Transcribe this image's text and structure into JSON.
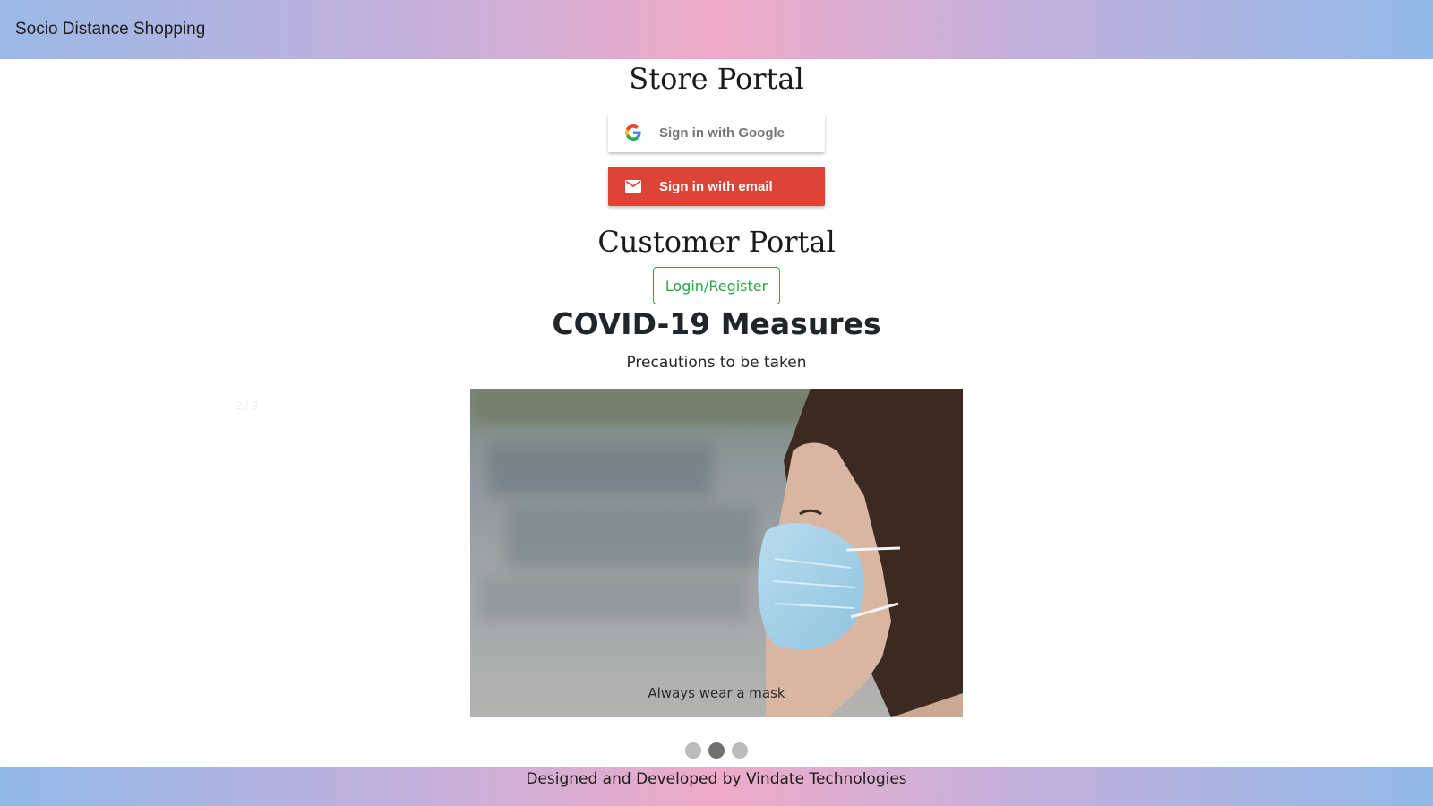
{
  "header": {
    "brand": "Socio Distance Shopping"
  },
  "store_portal": {
    "title": "Store Portal",
    "google_label": "Sign in with Google",
    "email_label": "Sign in with email"
  },
  "customer_portal": {
    "title": "Customer Portal",
    "login_label": "Login/Register"
  },
  "covid": {
    "title": "COVID-19 Measures",
    "subtitle": "Precautions to be taken",
    "slide_counter": "2 / 3",
    "caption": "Always wear a mask",
    "slides_total": 3,
    "active_slide": 2
  },
  "footer": {
    "text": "Designed and Developed by Vindate Technologies"
  },
  "colors": {
    "email_button": "#db4437",
    "login_outline": "#28a745",
    "active_dot": "#707070",
    "inactive_dot": "#bbbbbb"
  }
}
